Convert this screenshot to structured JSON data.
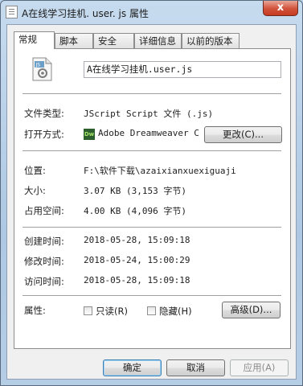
{
  "window": {
    "title": "A在线学习挂机. user. js 属性",
    "close_glyph": "x"
  },
  "tabs": [
    "常规",
    "脚本",
    "安全",
    "详细信息",
    "以前的版本"
  ],
  "file": {
    "name": "A在线学习挂机.user.js",
    "icon": "js-file-icon"
  },
  "type": {
    "label": "文件类型:",
    "value": "JScript Script 文件 (.js)"
  },
  "opens_with": {
    "label": "打开方式:",
    "app": "Adobe Dreamweaver C",
    "app_icon_text": "Dw",
    "change_button": "更改(C)..."
  },
  "location": {
    "label": "位置:",
    "value": "F:\\软件下载\\azaixianxuexiguaji"
  },
  "size": {
    "label": "大小:",
    "value": "3.07 KB (3,153 字节)"
  },
  "size_on_disk": {
    "label": "占用空间:",
    "value": "4.00 KB (4,096 字节)"
  },
  "created": {
    "label": "创建时间:",
    "value": "2018-05-28, 15:09:18"
  },
  "modified": {
    "label": "修改时间:",
    "value": "2018-05-24, 15:00:29"
  },
  "accessed": {
    "label": "访问时间:",
    "value": "2018-05-28, 15:09:18"
  },
  "attributes": {
    "label": "属性:",
    "readonly": "只读(R)",
    "hidden": "隐藏(H)",
    "advanced_button": "高级(D)..."
  },
  "footer": {
    "ok": "确定",
    "cancel": "取消",
    "apply": "应用(A)"
  }
}
